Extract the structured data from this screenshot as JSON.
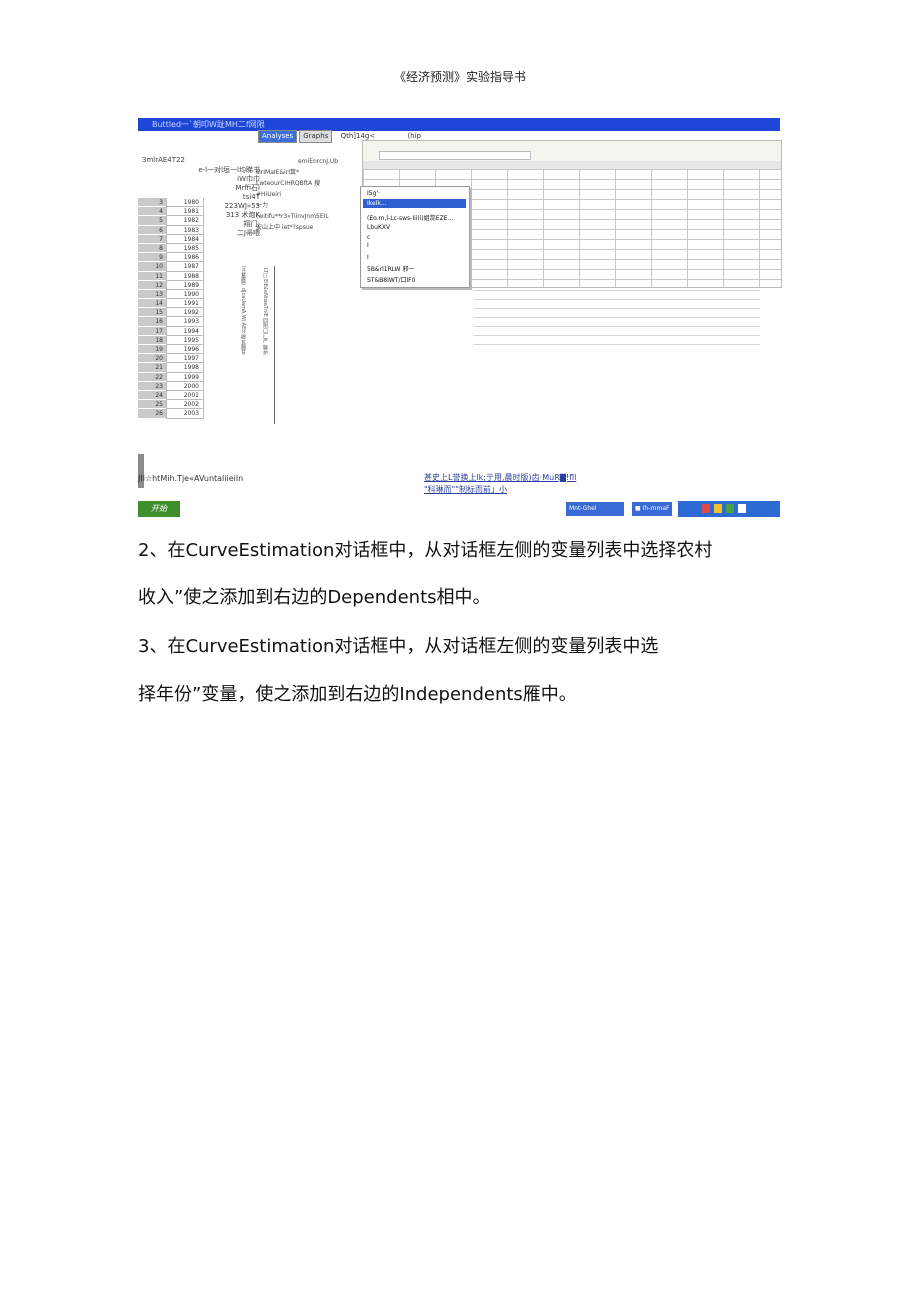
{
  "header": {
    "title": "《经济预测》实验指导书"
  },
  "screenshot": {
    "titlebar": "Buttled一`朝叩W趾MH二f网限",
    "tabs": [
      "Analyses",
      "Graphs",
      "Qth]14g<",
      "(hip"
    ],
    "left_label": "3mlrAE4T22",
    "left_panel_lines": [
      "e-l一对l垣一l均睇书",
      "iW巾巾",
      "Mrffi石l",
      "tsi4T",
      "223WJ»53",
      "313 术炮K",
      "翔门;",
      "二J帚喂"
    ],
    "mid_panel_lines": [
      "emiEnrcnJ.Ub",
      "sirIMaIE&irI箕*",
      "LwteourCIHRQBftA 搜",
      "#HiUeiri",
      "一力",
      "(witifu**r3«TiinvJnm5EiL",
      "安山上中 iet*?spsue"
    ],
    "vertical_texts": [
      "Irti蓄糜》dJcaUamA.Wi.AEtt  卿瓦翻甘",
      "LT□ElE£eNtwaTnlE 回附口厂严 聊炉"
    ],
    "context_menu": [
      "I5g'·",
      "Ikelk...",
      "(Eo.m,l-Lc-sws-Iii(i)姐蕊EZE...",
      "LbuKXV",
      "c",
      "I",
      "I",
      "5B&rl1RLW 邪一",
      "ST&B8IWT/口lF0"
    ],
    "rows": [
      {
        "n": "3",
        "y": "1980"
      },
      {
        "n": "4",
        "y": "1981"
      },
      {
        "n": "5",
        "y": "1982"
      },
      {
        "n": "6",
        "y": "1983"
      },
      {
        "n": "7",
        "y": "1984"
      },
      {
        "n": "8",
        "y": "1985"
      },
      {
        "n": "9",
        "y": "1986"
      },
      {
        "n": "10",
        "y": "1987"
      },
      {
        "n": "11",
        "y": "1988"
      },
      {
        "n": "12",
        "y": "1989"
      },
      {
        "n": "13",
        "y": "1990"
      },
      {
        "n": "14",
        "y": "1991"
      },
      {
        "n": "15",
        "y": "1992"
      },
      {
        "n": "16",
        "y": "1993"
      },
      {
        "n": "17",
        "y": "1994"
      },
      {
        "n": "18",
        "y": "1995"
      },
      {
        "n": "19",
        "y": "1996"
      },
      {
        "n": "20",
        "y": "1997"
      },
      {
        "n": "21",
        "y": "1998"
      },
      {
        "n": "22",
        "y": "1999"
      },
      {
        "n": "23",
        "y": "2000"
      },
      {
        "n": "24",
        "y": "2001"
      },
      {
        "n": "25",
        "y": "2002"
      },
      {
        "n": "26",
        "y": "2003"
      }
    ],
    "status_left": "JIl☆htMih.Tje«AVuntaliieiln",
    "status_mid_1": "甚史上L誉换上lk;亍用,晨时版)齿·MuR▇!fll",
    "status_mid_2": "\"科琳而\"\"制标而前」小",
    "start_label": "开始",
    "task1": "Mnt-Ghel",
    "task2": "■ Ih-rnmaF"
  },
  "paragraphs": [
    "2、在CurveEstimation对话框中，从对话框左侧的变量列表中选择农村",
    "收入”使之添加到右边的Dependents相中。",
    "3、在CurveEstimation对话框中，从对话框左侧的变量列表中选",
    "择年份”变量，使之添加到右边的Independents雁中。"
  ]
}
